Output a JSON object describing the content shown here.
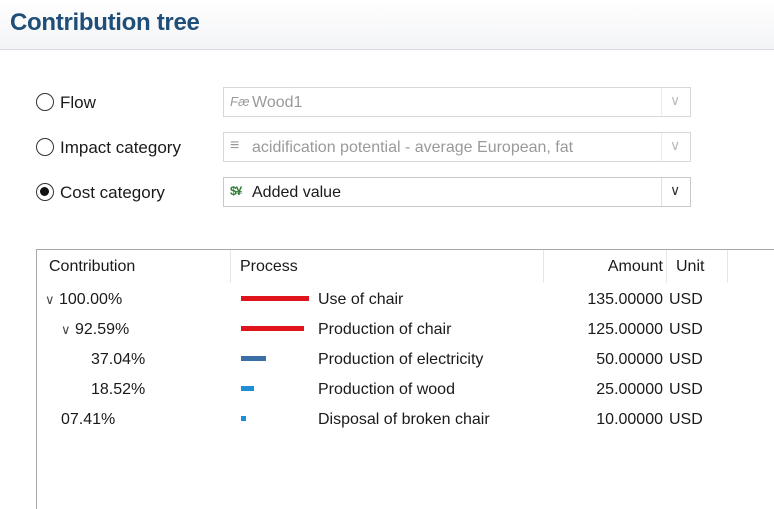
{
  "header": {
    "title": "Contribution tree"
  },
  "selectors": {
    "flow": {
      "label": "Flow",
      "icon_text": "Fæ",
      "icon": "flow-icon",
      "value": "Wood1",
      "checked": false,
      "enabled": false
    },
    "impact": {
      "label": "Impact category",
      "icon_text": "≡",
      "icon": "impact-category-icon",
      "value": "acidification potential - average European, fat",
      "checked": false,
      "enabled": false
    },
    "cost": {
      "label": "Cost category",
      "icon_text": "$¥",
      "icon": "cost-category-icon",
      "value": "Added value",
      "checked": true,
      "enabled": true
    }
  },
  "table": {
    "headers": {
      "contribution": "Contribution",
      "process": "Process",
      "amount": "Amount",
      "unit": "Unit"
    },
    "rows": [
      {
        "contribution": "100.00%",
        "level": 0,
        "expanded": true,
        "share": 1.0,
        "bar_color": "#e0141c",
        "process": "Use of chair",
        "amount": "135.00000",
        "unit": "USD"
      },
      {
        "contribution": "92.59%",
        "level": 1,
        "expanded": true,
        "share": 0.9259,
        "bar_color": "#e0141c",
        "process": "Production of chair",
        "amount": "125.00000",
        "unit": "USD"
      },
      {
        "contribution": "37.04%",
        "level": 2,
        "expanded": false,
        "share": 0.3704,
        "bar_color": "#3a6ea5",
        "process": "Production of electricity",
        "amount": "50.00000",
        "unit": "USD"
      },
      {
        "contribution": "18.52%",
        "level": 2,
        "expanded": false,
        "share": 0.1852,
        "bar_color": "#1e8fd6",
        "process": "Production of wood",
        "amount": "25.00000",
        "unit": "USD"
      },
      {
        "contribution": "07.41%",
        "level": 1,
        "expanded": false,
        "share": 0.0741,
        "bar_color": "#1e8fd6",
        "process": "Disposal of broken chair",
        "amount": "10.00000",
        "unit": "USD"
      }
    ]
  }
}
